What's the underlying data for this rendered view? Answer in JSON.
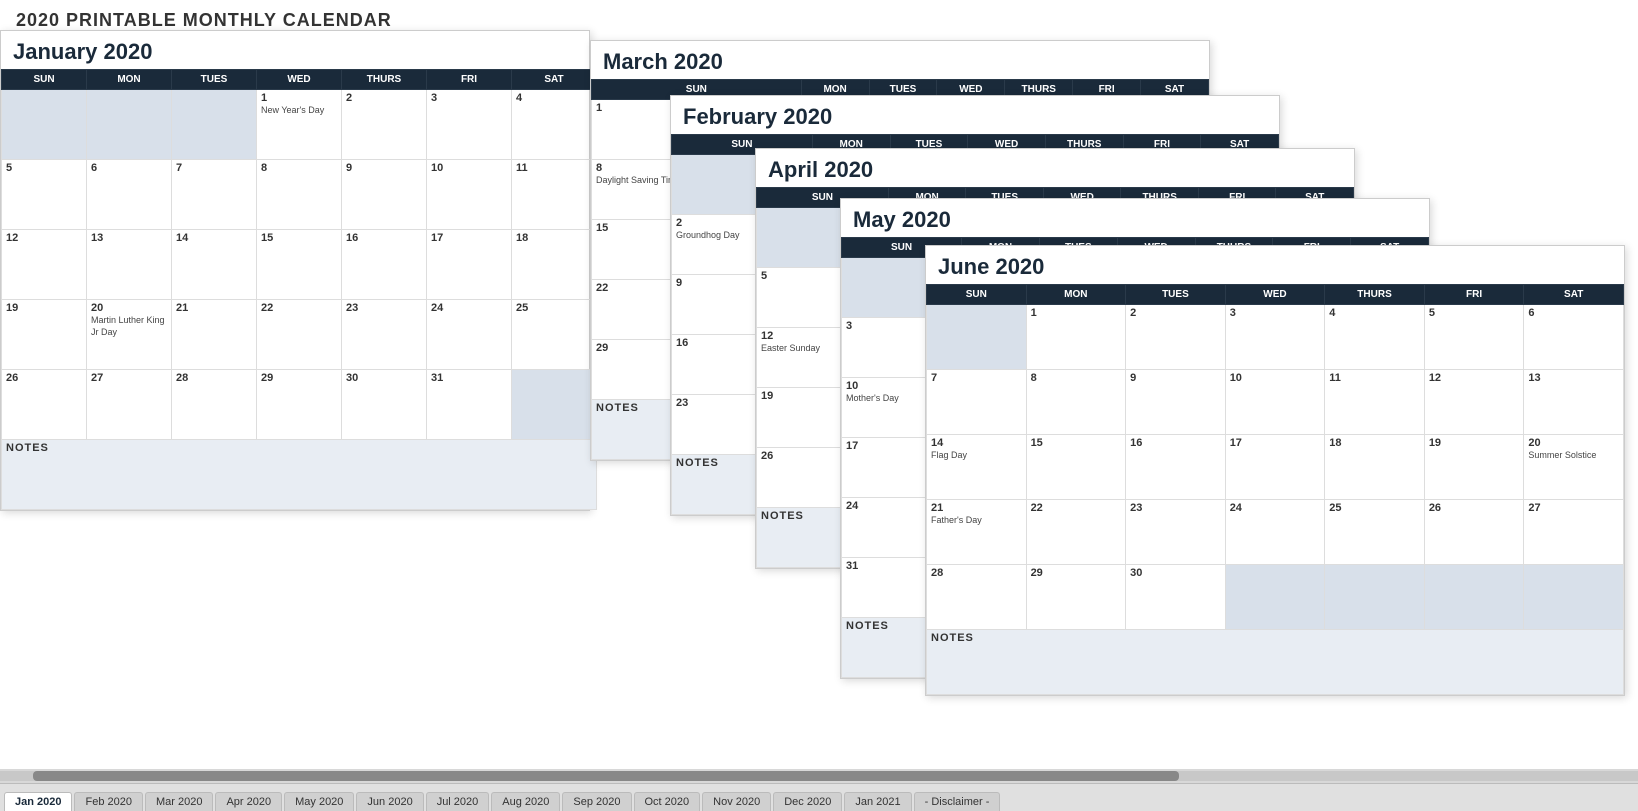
{
  "app": {
    "title": "2020 PRINTABLE MONTHLY CALENDAR"
  },
  "tabs": [
    {
      "label": "Jan 2020",
      "active": true
    },
    {
      "label": "Feb 2020",
      "active": false
    },
    {
      "label": "Mar 2020",
      "active": false
    },
    {
      "label": "Apr 2020",
      "active": false
    },
    {
      "label": "May 2020",
      "active": false
    },
    {
      "label": "Jun 2020",
      "active": false
    },
    {
      "label": "Jul 2020",
      "active": false
    },
    {
      "label": "Aug 2020",
      "active": false
    },
    {
      "label": "Sep 2020",
      "active": false
    },
    {
      "label": "Oct 2020",
      "active": false
    },
    {
      "label": "Nov 2020",
      "active": false
    },
    {
      "label": "Dec 2020",
      "active": false
    },
    {
      "label": "Jan 2021",
      "active": false
    },
    {
      "label": "- Disclaimer -",
      "active": false
    }
  ],
  "months": {
    "jan": {
      "title": "January 2020"
    },
    "feb": {
      "title": "February 2020"
    },
    "mar": {
      "title": "March 2020"
    },
    "apr": {
      "title": "April 2020"
    },
    "may": {
      "title": "May 2020"
    },
    "jun": {
      "title": "June 2020"
    }
  },
  "days": {
    "short": [
      "SUN",
      "MON",
      "TUES",
      "WED",
      "THURS",
      "FRI",
      "SAT"
    ]
  },
  "notes_label": "NOTES",
  "holidays": {
    "new_years": "New Year's Day",
    "mlk": "Martin Luther King Jr Day",
    "dst": "Daylight Saving Time Begins",
    "groundhog": "Groundhog Day",
    "easter": "Easter Sunday",
    "mothers": "Mother's Day",
    "flag": "Flag Day",
    "fathers": "Father's Day",
    "summer_solstice": "Summer Solstice"
  }
}
